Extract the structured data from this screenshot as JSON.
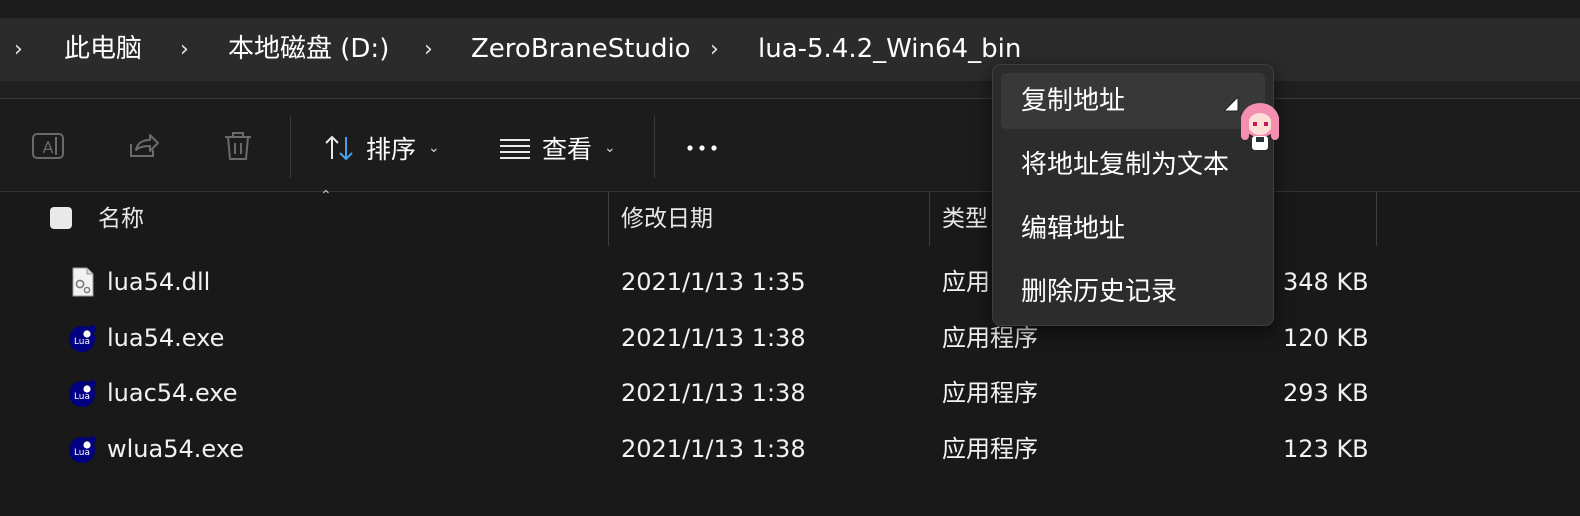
{
  "breadcrumb": {
    "items": [
      "此电脑",
      "本地磁盘 (D:)",
      "ZeroBraneStudio",
      "lua-5.4.2_Win64_bin"
    ]
  },
  "toolbar": {
    "sort_label": "排序",
    "view_label": "查看",
    "more_label": "···",
    "icons": [
      "rename-icon",
      "share-icon",
      "delete-icon",
      "sort-icon",
      "view-icon",
      "more-icon"
    ]
  },
  "columns": {
    "name": "名称",
    "modified": "修改日期",
    "type": "类型",
    "size": ""
  },
  "files": [
    {
      "name": "lua54.dll",
      "modified": "2021/1/13 1:35",
      "type": "应用",
      "size": "348 KB",
      "icon": "dll-file-icon"
    },
    {
      "name": "lua54.exe",
      "modified": "2021/1/13 1:38",
      "type": "应用程序",
      "size": "120 KB",
      "icon": "lua-icon"
    },
    {
      "name": "luac54.exe",
      "modified": "2021/1/13 1:38",
      "type": "应用程序",
      "size": "293 KB",
      "icon": "lua-icon"
    },
    {
      "name": "wlua54.exe",
      "modified": "2021/1/13 1:38",
      "type": "应用程序",
      "size": "123 KB",
      "icon": "lua-icon"
    }
  ],
  "lua_icon_text": "Lua",
  "context_menu": {
    "items": [
      "复制地址",
      "将地址复制为文本",
      "编辑地址",
      "删除历史记录"
    ]
  },
  "colors": {
    "background": "#191919",
    "address_bar": "#2b2b2b",
    "menu_bg": "#2c2c2c",
    "lua_blue": "#000080",
    "accent": "#4aa0e8"
  }
}
